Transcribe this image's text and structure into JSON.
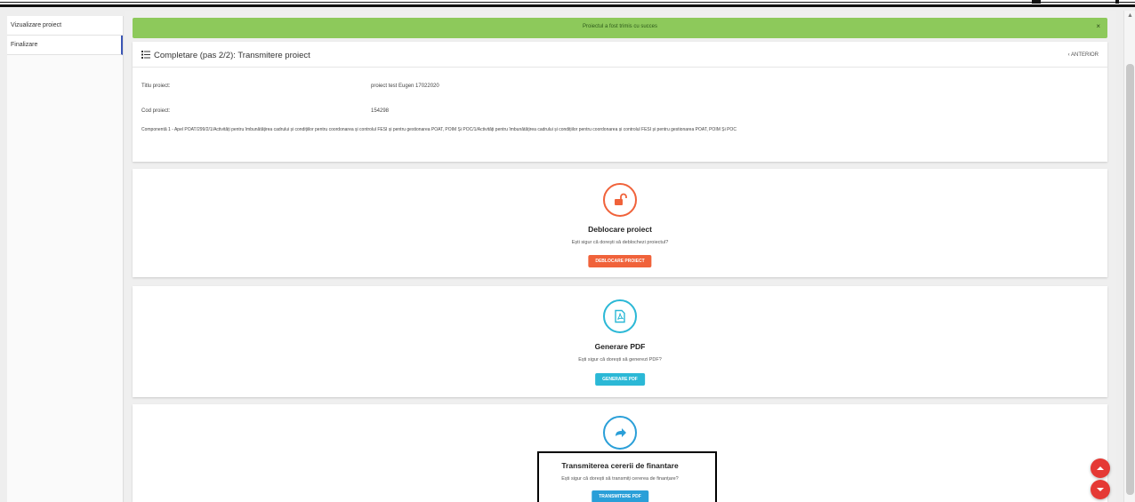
{
  "sidebar": {
    "items": [
      {
        "label": "Vizualizare proiect"
      },
      {
        "label": "Finalizare"
      }
    ]
  },
  "banner": {
    "message": "Proiectul a fost trimis cu succes",
    "close": "×"
  },
  "header": {
    "title": "Completare (pas 2/2): Transmitere proiect",
    "back": "‹ ANTERIOR"
  },
  "project": {
    "title_label": "Titlu proiect:",
    "title_value": "proiect test Eugen 17022020",
    "code_label": "Cod proiect:",
    "code_value": "154298",
    "component": "Componentă 1 - Apel   POAT/299/2/1/Activități pentru îmbunătățirea cadrului și condițiilor pentru coordonarea și controlul FESI și pentru gestionarea POAT, POIM Și POC/1/Activități pentru îmbunătățirea cadrului și condițiilor pentru coordonarea și controlul FESI și pentru gestionarea POAT, POIM Și POC"
  },
  "sections": {
    "unlock": {
      "icon": "unlock-icon",
      "title": "Deblocare proiect",
      "question": "Ești sigur că dorești să deblochezi proiectul?",
      "button": "DEBLOCARE PROIECT",
      "color": "#f0623a"
    },
    "pdf": {
      "icon": "pdf-icon",
      "title": "Generare PDF",
      "question": "Ești sigur că dorești să generezi PDF?",
      "button": "GENERARE PDF",
      "color": "#2bb8d6"
    },
    "submit": {
      "icon": "forward-arrow-icon",
      "title": "Transmiterea cererii de finantare",
      "question": "Ești sigur că dorești să transmiți cererea de finanțare?",
      "button": "TRANSMITERE PDF",
      "color": "#2a9fd8"
    }
  },
  "colors": {
    "accent": "#3a55b4",
    "success": "#8dc95b",
    "fab": "#e53935"
  }
}
